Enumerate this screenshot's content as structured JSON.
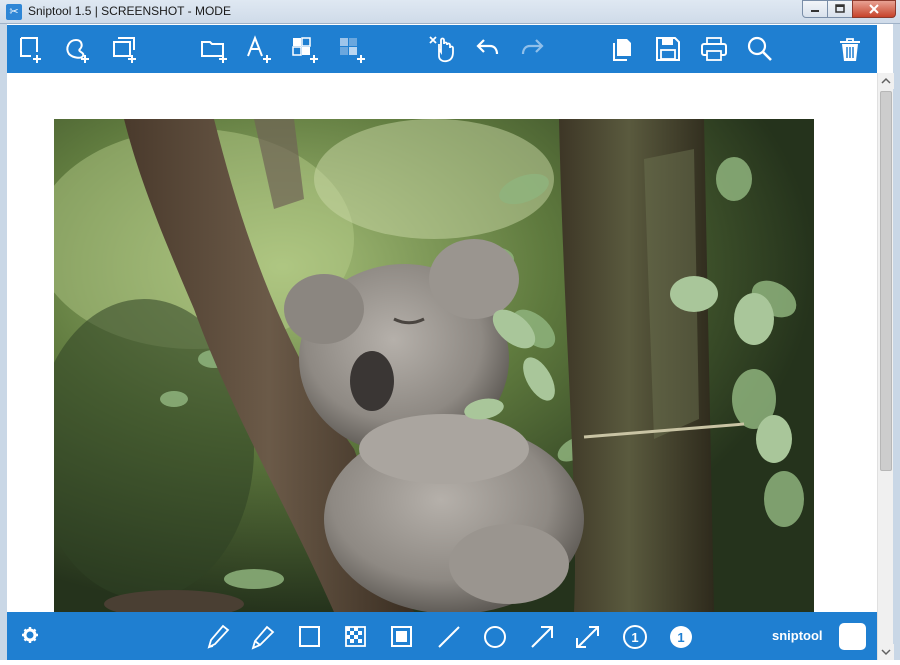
{
  "window": {
    "title": "Sniptool 1.5  |  SCREENSHOT - MODE",
    "app_icon": "scissors-icon",
    "controls": [
      "minimize-icon",
      "maximize-icon",
      "close-icon"
    ]
  },
  "top_toolbar": {
    "accent": "#1f7fd1",
    "tools": [
      "capture-rectangle-icon",
      "capture-freehand-icon",
      "capture-window-icon",
      "open-folder-icon",
      "add-text-icon",
      "add-grid-icon",
      "add-blur-icon",
      "select-pointer-icon",
      "undo-icon",
      "redo-icon",
      "copy-icon",
      "save-icon",
      "print-icon",
      "zoom-icon",
      "delete-icon"
    ]
  },
  "canvas": {
    "image": "koala-sleeping-in-tree-photo"
  },
  "bottom_toolbar": {
    "tools": [
      "settings-gear-icon",
      "pen-icon",
      "marker-icon",
      "rectangle-icon",
      "pixelate-icon",
      "filled-rectangle-icon",
      "line-icon",
      "circle-icon",
      "arrow-icon",
      "double-arrow-icon",
      "step-number-outline-icon",
      "step-number-filled-icon"
    ],
    "step_outline_number": "1",
    "step_filled_number": "1",
    "brand": "sniptool",
    "color_swatch": "#ffffff"
  }
}
